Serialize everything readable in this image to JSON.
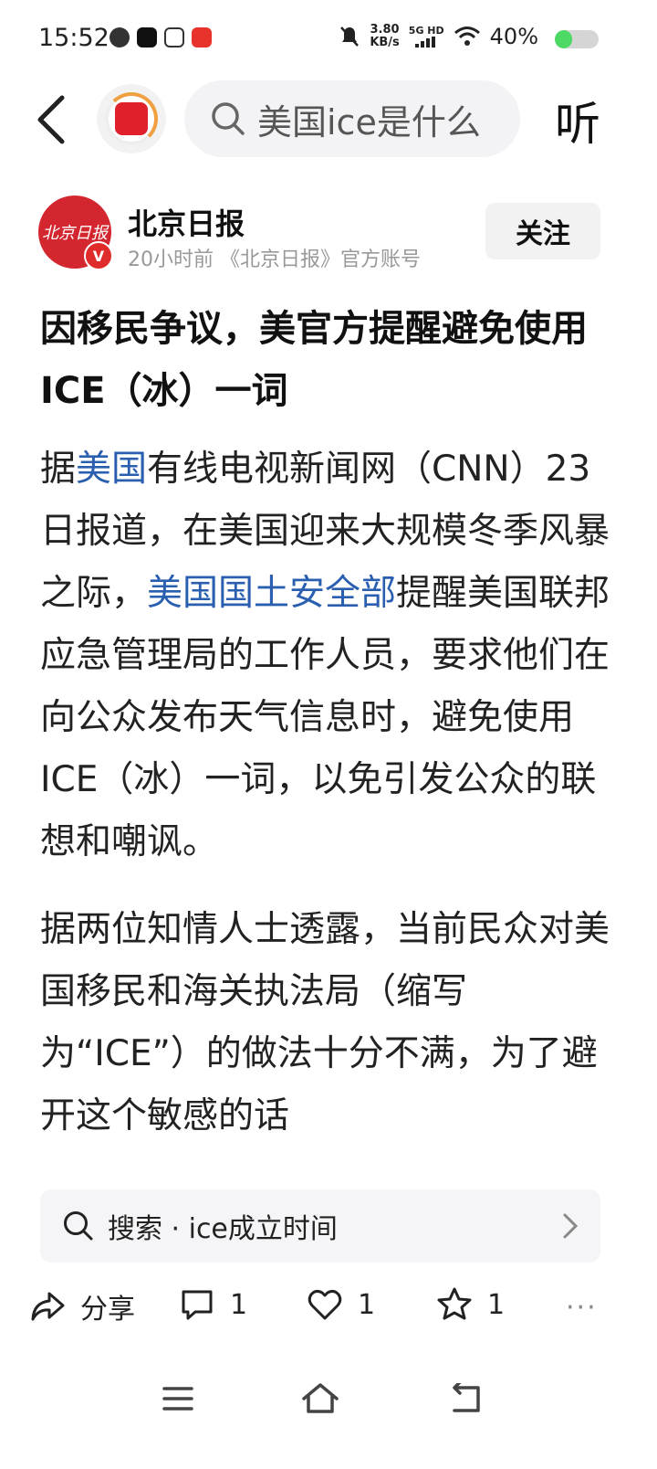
{
  "status_bar": {
    "time": "15:52",
    "speed_value": "3.80",
    "speed_unit": "KB/s",
    "network": "5G HD",
    "battery_text": "40%",
    "battery_level": 0.4
  },
  "top_bar": {
    "search_query": "美国ice是什么",
    "listen_label": "听"
  },
  "author": {
    "avatar_text": "北京日报",
    "verified_mark": "V",
    "name": "北京日报",
    "meta": "20小时前 《北京日报》官方账号",
    "follow_label": "关注"
  },
  "article": {
    "title": "因移民争议，美官方提醒避免使用ICE（冰）一词",
    "p1_s1": "据",
    "p1_link1": "美国",
    "p1_s2": "有线电视新闻网（CNN）23日报道，在美国迎来大规模冬季风暴之际，",
    "p1_link2": "美国国土安全部",
    "p1_s3": "提醒美国联邦应急管理局的工作人员，要求他们在向公众发布天气信息时，避免使用ICE（冰）一词，以免引发公众的联想和嘲讽。",
    "p2": "据两位知情人士透露，当前民众对美国移民和海关执法局（缩写为“ICE”）的做法十分不满，为了避开这个敏感的话"
  },
  "related_search": {
    "label": "搜索 · ice成立时间"
  },
  "actions": {
    "share_label": "分享",
    "comment_count": "1",
    "like_count": "1",
    "favorite_count": "1",
    "more_label": "···"
  },
  "colors": {
    "link": "#2a5fb0",
    "brand_red": "#d3262e",
    "battery_green": "#4cd964"
  }
}
